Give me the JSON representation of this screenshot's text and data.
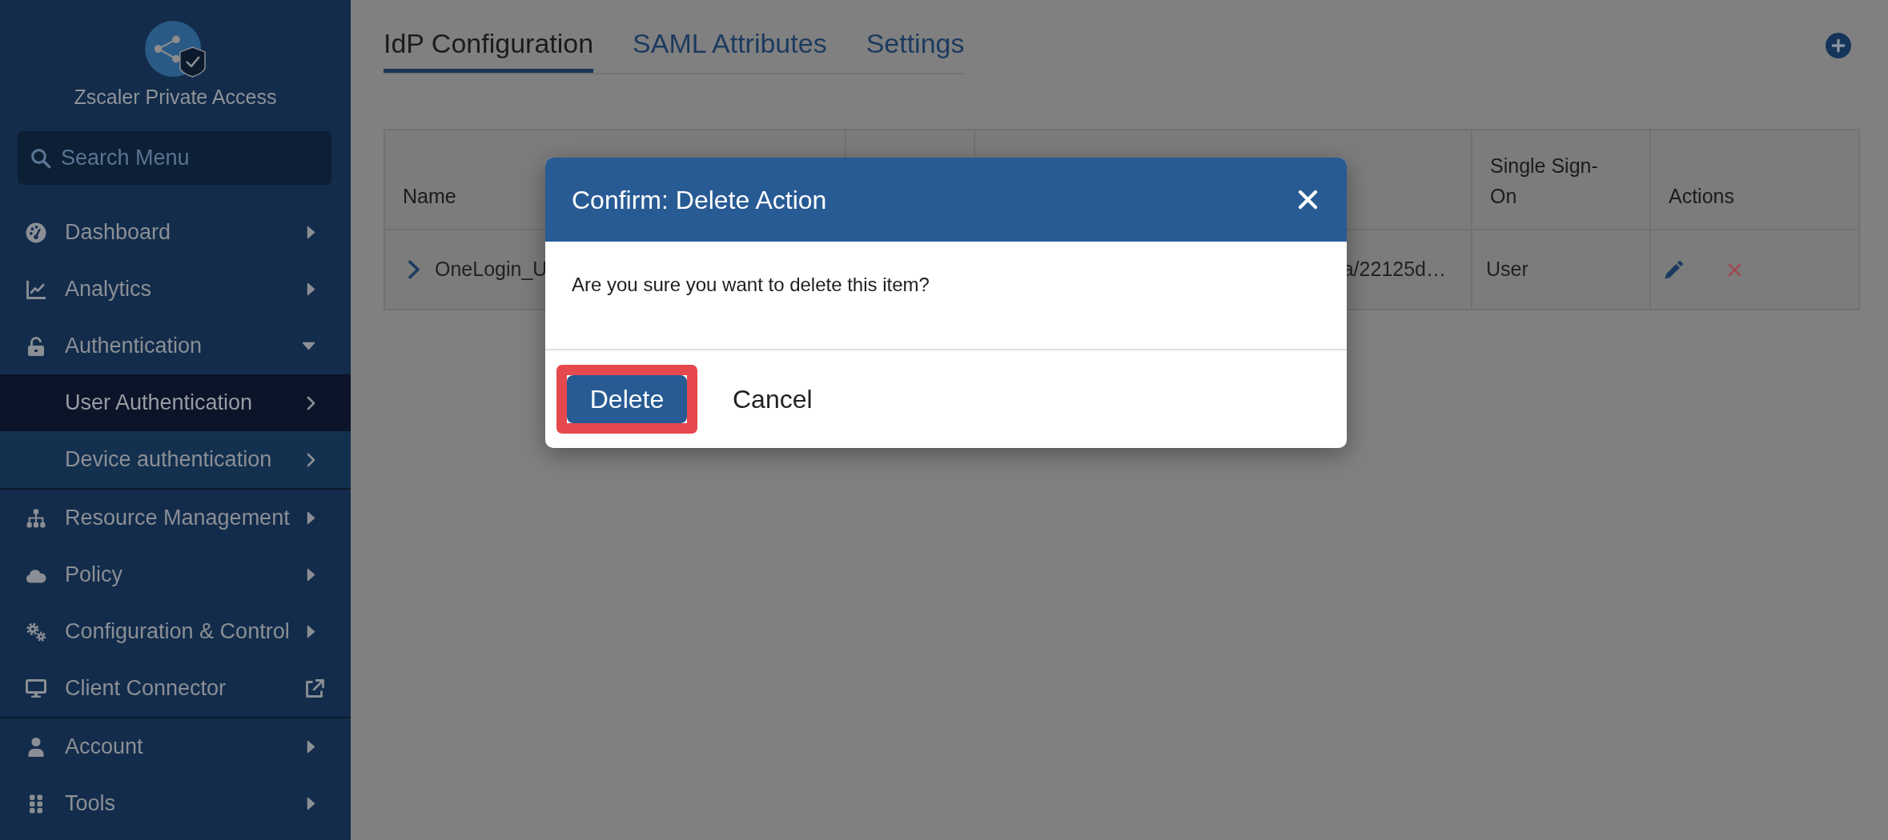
{
  "app": {
    "title": "Zscaler Private Access"
  },
  "sidebar": {
    "search": {
      "placeholder": "Search Menu"
    },
    "sections": [
      {
        "items": [
          {
            "label": "Dashboard",
            "kind": "menu",
            "expanded": false,
            "selected": false
          },
          {
            "label": "Analytics",
            "kind": "menu",
            "expanded": false,
            "selected": false
          },
          {
            "label": "Authentication",
            "kind": "menu",
            "expanded": true,
            "selected": false,
            "children": [
              {
                "label": "User Authentication",
                "selected": true
              },
              {
                "label": "Device authentication",
                "selected": false
              }
            ]
          }
        ]
      },
      {
        "items": [
          {
            "label": "Resource Management",
            "kind": "menu",
            "expanded": false,
            "selected": false
          },
          {
            "label": "Policy",
            "kind": "menu",
            "expanded": false,
            "selected": false
          },
          {
            "label": "Configuration & Control",
            "kind": "menu",
            "expanded": false,
            "selected": false
          },
          {
            "label": "Client Connector",
            "kind": "external",
            "selected": false
          }
        ]
      },
      {
        "items": [
          {
            "label": "Account",
            "kind": "menu",
            "expanded": false,
            "selected": false
          },
          {
            "label": "Tools",
            "kind": "menu",
            "expanded": false,
            "selected": false
          }
        ]
      }
    ]
  },
  "tabs": [
    {
      "label": "IdP Configuration",
      "selected": true
    },
    {
      "label": "SAML Attributes",
      "selected": false
    },
    {
      "label": "Settings",
      "selected": false
    }
  ],
  "table": {
    "columns": [
      {
        "label": "Name"
      },
      {},
      {},
      {
        "label": "Single Sign-On"
      },
      {
        "label": "Actions"
      }
    ],
    "rows": [
      {
        "expanded": false,
        "name": "OneLogin_U",
        "column_3": "a/22125d…",
        "single_sign_on": "User"
      }
    ]
  },
  "modal": {
    "title": "Confirm: Delete Action",
    "message": "Are you sure you want to delete this item?",
    "buttons": [
      {
        "label": "Delete",
        "kind": "primary",
        "highlighted": true
      },
      {
        "label": "Cancel",
        "kind": "link",
        "highlighted": false
      }
    ]
  }
}
